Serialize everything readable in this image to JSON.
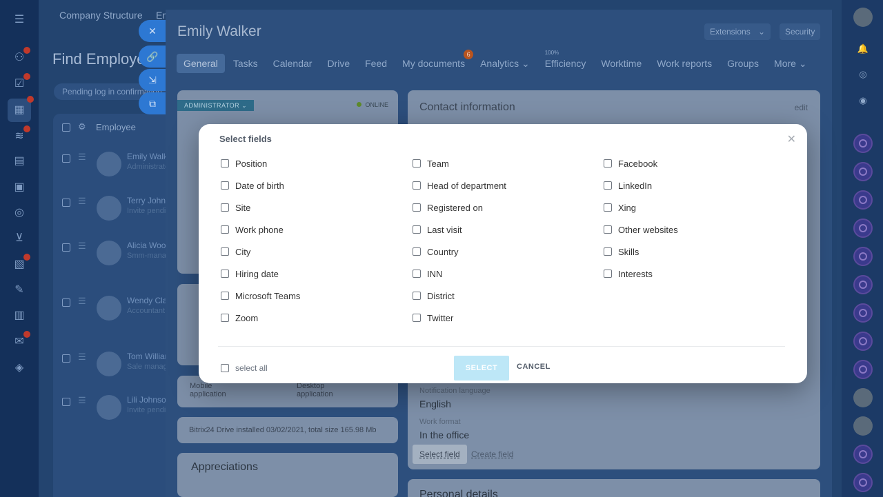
{
  "left_bar": {
    "icons": [
      {
        "name": "menu-icon",
        "glyph": "☰"
      },
      {
        "name": "activity-icon",
        "glyph": "⚇",
        "badge": true
      },
      {
        "name": "tasks-icon",
        "glyph": "☑",
        "badge": true
      },
      {
        "name": "employees-icon",
        "glyph": "▦",
        "badge": true,
        "active": true
      },
      {
        "name": "crm-icon",
        "glyph": "≋",
        "badge": true
      },
      {
        "name": "calendar-icon",
        "glyph": "▤"
      },
      {
        "name": "drive-icon",
        "glyph": "▣"
      },
      {
        "name": "automation-icon",
        "glyph": "◎"
      },
      {
        "name": "shop-icon",
        "glyph": "⊻"
      },
      {
        "name": "docs-icon",
        "glyph": "▧",
        "badge": true
      },
      {
        "name": "sign-icon",
        "glyph": "✎"
      },
      {
        "name": "analytics-icon",
        "glyph": "▥"
      },
      {
        "name": "mail-icon",
        "glyph": "✉",
        "badge": true
      },
      {
        "name": "market-icon",
        "glyph": "◈"
      }
    ]
  },
  "background": {
    "tabs": [
      "Company Structure",
      "Em"
    ],
    "page_title": "Find Employee",
    "pill": "Pending log in confirmation",
    "list_header": "Employee",
    "rows": [
      {
        "name": "Emily Walker",
        "sub": "Administrator"
      },
      {
        "name": "Terry Johnson",
        "sub": "Invite pending"
      },
      {
        "name": "Alicia Wood",
        "sub": "Smm-manager"
      },
      {
        "name": "Wendy Clark",
        "sub": "Accountant"
      },
      {
        "name": "Tom Williams",
        "sub": "Sale manager"
      },
      {
        "name": "Lili Johnson",
        "sub": "Invite pending"
      }
    ]
  },
  "profile": {
    "name": "Emily Walker",
    "buttons": {
      "extensions": "Extensions",
      "security": "Security"
    },
    "tabs": [
      {
        "label": "General",
        "active": true
      },
      {
        "label": "Tasks"
      },
      {
        "label": "Calendar"
      },
      {
        "label": "Drive"
      },
      {
        "label": "Feed"
      },
      {
        "label": "My documents",
        "badge": "6"
      },
      {
        "label": "Analytics ⌄"
      },
      {
        "label": "Efficiency",
        "sup": "100%"
      },
      {
        "label": "Worktime"
      },
      {
        "label": "Work reports"
      },
      {
        "label": "Groups"
      },
      {
        "label": "More ⌄"
      }
    ],
    "admin_tag": "ADMINISTRATOR ⌄",
    "online": "ONLINE",
    "contact_title": "Contact information",
    "contact_edit": "edit",
    "notification_label": "Notification language",
    "notification_value": "English",
    "work_format_label": "Work format",
    "work_format_value": "In the office",
    "select_field": "Select field",
    "create_field": "Create field",
    "mobile_app": "Mobile application",
    "desktop_app": "Desktop application",
    "drive_info": "Bitrix24 Drive installed 03/02/2021, total size 165.98 Mb",
    "appreciations": "Appreciations",
    "personal_details": "Personal details"
  },
  "modal": {
    "title": "Select fields",
    "columns": [
      [
        "Position",
        "Date of birth",
        "Site",
        "Work phone",
        "City",
        "Hiring date",
        "Microsoft Teams",
        "Zoom"
      ],
      [
        "Team",
        "Head of department",
        "Registered on",
        "Last visit",
        "Country",
        "INN",
        "District",
        "Twitter"
      ],
      [
        "Facebook",
        "LinkedIn",
        "Xing",
        "Other websites",
        "Skills",
        "Interests"
      ]
    ],
    "select_all": "select all",
    "select_button": "SELECT",
    "cancel_button": "CANCEL"
  }
}
